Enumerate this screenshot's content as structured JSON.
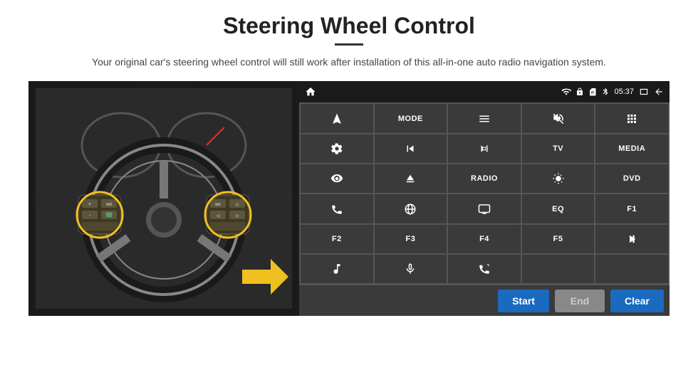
{
  "page": {
    "title": "Steering Wheel Control",
    "subtitle": "Your original car's steering wheel control will still work after installation of this all-in-one auto radio navigation system."
  },
  "status_bar": {
    "time": "05:37",
    "wifi_icon": "wifi",
    "lock_icon": "lock",
    "battery_icon": "battery",
    "bluetooth_icon": "bluetooth",
    "home_icon": "home",
    "back_icon": "back"
  },
  "buttons": [
    {
      "id": "nav",
      "type": "icon",
      "icon": "navigate"
    },
    {
      "id": "mode",
      "type": "text",
      "label": "MODE"
    },
    {
      "id": "menu",
      "type": "icon",
      "icon": "menu"
    },
    {
      "id": "mute",
      "type": "icon",
      "icon": "mute"
    },
    {
      "id": "apps",
      "type": "icon",
      "icon": "apps"
    },
    {
      "id": "settings",
      "type": "icon",
      "icon": "settings"
    },
    {
      "id": "prev",
      "type": "icon",
      "icon": "prev"
    },
    {
      "id": "next",
      "type": "icon",
      "icon": "next"
    },
    {
      "id": "tv",
      "type": "text",
      "label": "TV"
    },
    {
      "id": "media",
      "type": "text",
      "label": "MEDIA"
    },
    {
      "id": "cam360",
      "type": "icon",
      "icon": "360cam"
    },
    {
      "id": "eject",
      "type": "icon",
      "icon": "eject"
    },
    {
      "id": "radio",
      "type": "text",
      "label": "RADIO"
    },
    {
      "id": "brightness",
      "type": "icon",
      "icon": "brightness"
    },
    {
      "id": "dvd",
      "type": "text",
      "label": "DVD"
    },
    {
      "id": "phone",
      "type": "icon",
      "icon": "phone"
    },
    {
      "id": "browse",
      "type": "icon",
      "icon": "browse"
    },
    {
      "id": "screen",
      "type": "icon",
      "icon": "screen"
    },
    {
      "id": "eq",
      "type": "text",
      "label": "EQ"
    },
    {
      "id": "f1",
      "type": "text",
      "label": "F1"
    },
    {
      "id": "f2",
      "type": "text",
      "label": "F2"
    },
    {
      "id": "f3",
      "type": "text",
      "label": "F3"
    },
    {
      "id": "f4",
      "type": "text",
      "label": "F4"
    },
    {
      "id": "f5",
      "type": "text",
      "label": "F5"
    },
    {
      "id": "playpause",
      "type": "icon",
      "icon": "playpause"
    },
    {
      "id": "music",
      "type": "icon",
      "icon": "music"
    },
    {
      "id": "mic",
      "type": "icon",
      "icon": "mic"
    },
    {
      "id": "phonecall",
      "type": "icon",
      "icon": "phonecall"
    },
    {
      "id": "empty1",
      "type": "empty"
    },
    {
      "id": "empty2",
      "type": "empty"
    }
  ],
  "action_bar": {
    "start_label": "Start",
    "end_label": "End",
    "clear_label": "Clear"
  }
}
